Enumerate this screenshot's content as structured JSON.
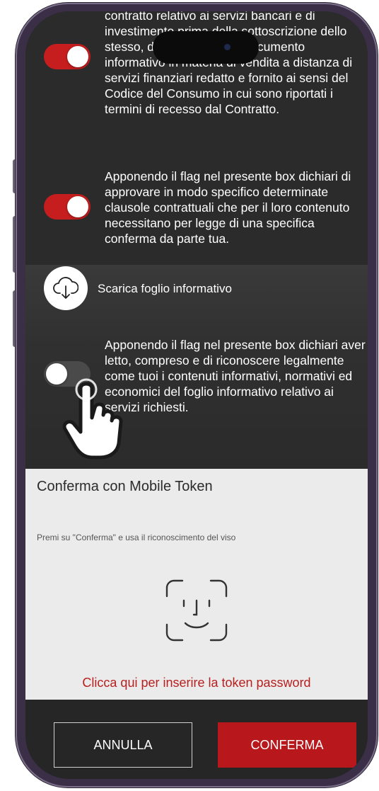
{
  "consents": [
    {
      "text": "contratto relativo ai servizi bancari e di investimento prima della sottoscrizione dello stesso, di aver ricevuto il documento informativo in materia di vendita a distanza di servizi finanziari redatto e fornito ai sensi del Codice del Consumo in cui sono riportati i termini di recesso dal Contratto.",
      "checked": true
    },
    {
      "text": "Apponendo il flag nel presente box dichiari di approvare in modo specifico determinate clausole contrattuali che per il loro contenuto necessitano per legge di una specifica conferma da parte tua.",
      "checked": true
    },
    {
      "text": "Apponendo il flag nel presente box dichiari aver letto, compreso e di riconoscere legalmente come tuoi i contenuti informativi, normativi ed economici del foglio informativo relativo ai servizi richiesti.",
      "checked": false
    }
  ],
  "download": {
    "label": "Scarica foglio informativo",
    "icon": "cloud-download-icon"
  },
  "token_panel": {
    "title": "Conferma con Mobile Token",
    "instruction": "Premi su \"Conferma\" e usa il riconoscimento del viso",
    "icon": "face-id-icon",
    "password_link": "Clicca qui per inserire la token password"
  },
  "actions": {
    "cancel_label": "ANNULLA",
    "confirm_label": "CONFERMA"
  },
  "colors": {
    "accent": "#b8171b",
    "toggle_on": "#c61e1e",
    "background_dark": "#2b2b2b",
    "panel_light": "#ebebeb"
  }
}
